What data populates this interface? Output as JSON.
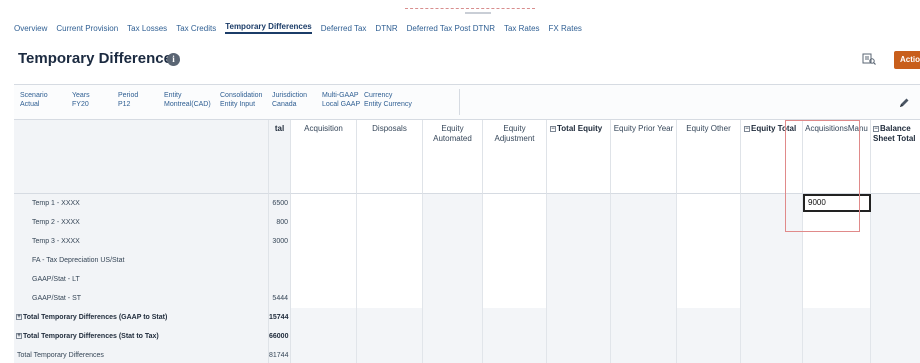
{
  "tabs": [
    {
      "label": "Overview"
    },
    {
      "label": "Current Provision"
    },
    {
      "label": "Tax Losses"
    },
    {
      "label": "Tax Credits"
    },
    {
      "label": "Temporary Differences",
      "active": true
    },
    {
      "label": "Deferred Tax"
    },
    {
      "label": "DTNR"
    },
    {
      "label": "Deferred Tax Post DTNR"
    },
    {
      "label": "Tax Rates"
    },
    {
      "label": "FX Rates"
    }
  ],
  "page": {
    "title": "Temporary Differences",
    "actions_label": "Actio"
  },
  "icons": {
    "info": "info-icon",
    "report": "report-icon",
    "edit": "pencil-icon"
  },
  "pov": [
    {
      "label": "Scenario",
      "value": "Actual"
    },
    {
      "label": "Years",
      "value": "FY20"
    },
    {
      "label": "Period",
      "value": "P12"
    },
    {
      "label": "Entity",
      "value": "Montreal(CAD)"
    },
    {
      "label": "Consolidation",
      "value": "Entity Input"
    },
    {
      "label": "Jurisdiction",
      "value": "Canada"
    },
    {
      "label": "Multi-GAAP",
      "value": "Local GAAP"
    },
    {
      "label": "Currency",
      "value": "Entity Currency"
    }
  ],
  "grid": {
    "first_header": "tal",
    "columns": [
      {
        "label": "Acquisition"
      },
      {
        "label": "Disposals"
      },
      {
        "label": "Equity Automated"
      },
      {
        "label": "Equity Adjustment"
      },
      {
        "label": "Total Equity",
        "bold": true,
        "collapsible": true
      },
      {
        "label": "Equity Prior Year"
      },
      {
        "label": "Equity Other"
      },
      {
        "label": "Equity Total",
        "bold": true,
        "collapsible": true
      },
      {
        "label": "AcquisitionsManu"
      },
      {
        "label": "Balance Sheet Total",
        "bold": true,
        "collapsible": true
      }
    ],
    "rows": [
      {
        "label": "Temp 1 - XXXX",
        "total": "6500",
        "editor_value": "9000"
      },
      {
        "label": "Temp 2 - XXXX",
        "total": "800"
      },
      {
        "label": "Temp 3 - XXXX",
        "total": "3000"
      },
      {
        "label": "FA - Tax Depreciation US/Stat",
        "total": ""
      },
      {
        "label": "GAAP/Stat - LT",
        "total": ""
      },
      {
        "label": "GAAP/Stat - ST",
        "total": "5444"
      },
      {
        "label": "Total Temporary Differences (GAAP to Stat)",
        "total": "15744",
        "kind": "total"
      },
      {
        "label": "Total Temporary Differences (Stat to Tax)",
        "total": "66000",
        "kind": "total"
      },
      {
        "label": "Total Temporary Differences",
        "total": "81744",
        "kind": "plain"
      }
    ]
  },
  "colors": {
    "accent": "#c85e1b",
    "link": "#2f5f93",
    "highlight": "#e08a8a"
  }
}
